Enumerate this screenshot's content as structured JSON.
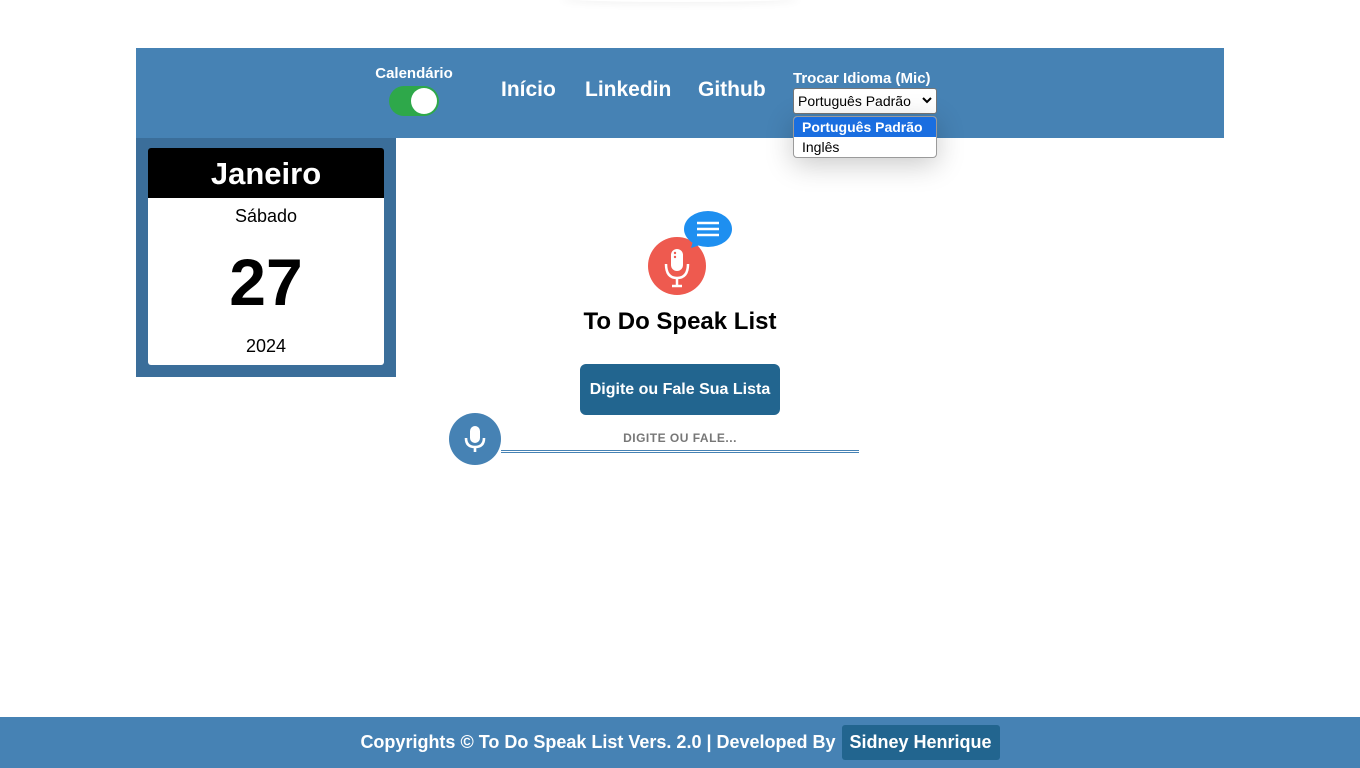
{
  "header": {
    "calendar_toggle_label": "Calendário",
    "calendar_toggle_on": true,
    "nav_links": [
      "Início",
      "Linkedin",
      "Github"
    ],
    "language": {
      "label": "Trocar Idioma (Mic)",
      "selected": "Português Padrão",
      "options": [
        "Português Padrão",
        "Inglês"
      ]
    }
  },
  "calendar": {
    "month": "Janeiro",
    "weekday": "Sábado",
    "day": "27",
    "year": "2024"
  },
  "main": {
    "title": "To Do Speak List",
    "cta_label": "Digite ou Fale Sua Lista",
    "input_placeholder": "DIGITE OU FALE..."
  },
  "footer": {
    "text": "Copyrights © To Do Speak List Vers. 2.0 | Developed By",
    "author": "Sidney Henrique"
  },
  "colors": {
    "primary": "#4682b4",
    "dark_primary": "#22658f",
    "toggle_on": "#2ea84a",
    "logo_red": "#ee5a4f",
    "logo_blue": "#1e8ff0"
  },
  "icons": [
    "microphone-icon",
    "chat-bubble-icon",
    "chevron-down-icon"
  ]
}
